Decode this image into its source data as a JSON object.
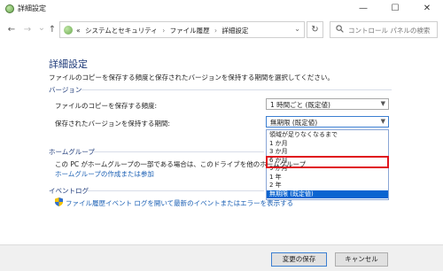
{
  "window": {
    "title": "詳細設定",
    "minimize": "—",
    "maximize": "☐",
    "close": "✕"
  },
  "nav": {
    "back": "←",
    "forward": "→",
    "dropdown": "⌄",
    "up": "↑",
    "address_prefix": "«",
    "breadcrumbs": [
      "システムとセキュリティ",
      "ファイル履歴",
      "詳細設定"
    ],
    "separator": "›",
    "refresh": "↻",
    "search_placeholder": "コントロール パネルの検索"
  },
  "main": {
    "title": "詳細設定",
    "description": "ファイルのコピーを保存する頻度と保存されたバージョンを保持する期間を選択してください。",
    "versions": {
      "header": "バージョン",
      "frequency_label": "ファイルのコピーを保存する頻度:",
      "frequency_value": "1 時間ごと (既定値)",
      "retention_label": "保存されたバージョンを保持する期間:",
      "retention_value": "無期限 (既定値)",
      "retention_options": [
        "領域が足りなくなるまで",
        "1 か月",
        "3 か月",
        "6 か月",
        "9 か月",
        "1 年",
        "2 年",
        "無期限 (既定値)"
      ],
      "selected_option": "無期限 (既定値)",
      "highlighted_option": "6 か月"
    },
    "homegroup": {
      "header": "ホームグループ",
      "text": "この PC がホームグループの一部である場合は、このドライブを他のホームグループ",
      "link": "ホームグループの作成または参加"
    },
    "eventlog": {
      "header": "イベントログ",
      "link": "ファイル履歴イベント ログを開いて最新のイベントまたはエラーを表示する"
    }
  },
  "footer": {
    "save": "変更の保存",
    "cancel": "キャンセル"
  },
  "colors": {
    "accent": "#1f3b7a",
    "link": "#1a5fb4",
    "selection": "#0a64d0",
    "highlight": "#e0141e"
  }
}
